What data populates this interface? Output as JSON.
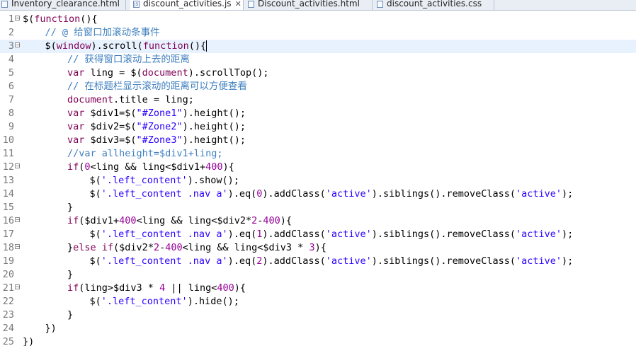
{
  "tabs": [
    {
      "label": "Inventory_clearance.html",
      "type": "html",
      "active": false,
      "closable": false
    },
    {
      "label": "discount_activities.js",
      "type": "js",
      "active": true,
      "closable": true
    },
    {
      "label": "Discount_activities.html",
      "type": "html",
      "active": false,
      "closable": false
    },
    {
      "label": "discount_activities.css",
      "type": "css",
      "active": false,
      "closable": false
    }
  ],
  "tab_icons": {
    "html": "html-file-icon",
    "js": "js-file-icon",
    "css": "css-file-icon"
  },
  "tab_close_label": "✕",
  "colors": {
    "comment": "#3f7fbf",
    "keyword": "#7f0055",
    "string": "#2a00ff",
    "number": "#990099",
    "plain": "#000000",
    "line_number": "#787878",
    "current_line": "#e8f2fe"
  },
  "editor": {
    "current_line": 3,
    "lines": [
      {
        "n": "1",
        "fold": true,
        "indent": 0,
        "tokens": [
          [
            "plain",
            "$("
          ],
          [
            "keyword",
            "function"
          ],
          [
            "plain",
            "(){"
          ]
        ]
      },
      {
        "n": "2",
        "fold": false,
        "indent": 1,
        "tokens": [
          [
            "comment",
            "// @ 给窗口加滚动条事件"
          ]
        ]
      },
      {
        "n": "3",
        "fold": true,
        "indent": 1,
        "caret": true,
        "tokens": [
          [
            "plain",
            "$("
          ],
          [
            "keyword",
            "window"
          ],
          [
            "plain",
            ").scroll("
          ],
          [
            "keyword",
            "function"
          ],
          [
            "plain",
            "(){"
          ]
        ]
      },
      {
        "n": "4",
        "fold": false,
        "indent": 2,
        "tokens": [
          [
            "comment",
            "// 获得窗口滚动上去的距离"
          ]
        ]
      },
      {
        "n": "5",
        "fold": false,
        "indent": 2,
        "tokens": [
          [
            "keyword",
            "var"
          ],
          [
            "plain",
            " ling = $("
          ],
          [
            "keyword",
            "document"
          ],
          [
            "plain",
            ").scrollTop();"
          ]
        ]
      },
      {
        "n": "6",
        "fold": false,
        "indent": 2,
        "tokens": [
          [
            "comment",
            "// 在标题栏显示滚动的距离可以方便查看"
          ]
        ]
      },
      {
        "n": "7",
        "fold": false,
        "indent": 2,
        "tokens": [
          [
            "keyword",
            "document"
          ],
          [
            "plain",
            ".title = ling;"
          ]
        ]
      },
      {
        "n": "8",
        "fold": false,
        "indent": 2,
        "tokens": [
          [
            "keyword",
            "var"
          ],
          [
            "plain",
            " $div1=$("
          ],
          [
            "string",
            "\"#Zone1\""
          ],
          [
            "plain",
            ").height();"
          ]
        ]
      },
      {
        "n": "9",
        "fold": false,
        "indent": 2,
        "tokens": [
          [
            "keyword",
            "var"
          ],
          [
            "plain",
            " $div2=$("
          ],
          [
            "string",
            "\"#Zone2\""
          ],
          [
            "plain",
            ").height();"
          ]
        ]
      },
      {
        "n": "10",
        "fold": false,
        "indent": 2,
        "tokens": [
          [
            "keyword",
            "var"
          ],
          [
            "plain",
            " $div3=$("
          ],
          [
            "string",
            "\"#Zone3\""
          ],
          [
            "plain",
            ").height();"
          ]
        ]
      },
      {
        "n": "11",
        "fold": false,
        "indent": 2,
        "tokens": [
          [
            "comment",
            "//var allheight=$div1+ling;"
          ]
        ]
      },
      {
        "n": "12",
        "fold": true,
        "indent": 2,
        "tokens": [
          [
            "keyword",
            "if"
          ],
          [
            "plain",
            "("
          ],
          [
            "number",
            "0"
          ],
          [
            "plain",
            "<ling && ling<$div1+"
          ],
          [
            "number",
            "400"
          ],
          [
            "plain",
            "){"
          ]
        ]
      },
      {
        "n": "13",
        "fold": false,
        "indent": 3,
        "tokens": [
          [
            "plain",
            "$("
          ],
          [
            "string",
            "'.left_content'"
          ],
          [
            "plain",
            ").show();"
          ]
        ]
      },
      {
        "n": "14",
        "fold": false,
        "indent": 3,
        "tokens": [
          [
            "plain",
            "$("
          ],
          [
            "string",
            "'.left_content .nav a'"
          ],
          [
            "plain",
            ").eq("
          ],
          [
            "number",
            "0"
          ],
          [
            "plain",
            ").addClass("
          ],
          [
            "string",
            "'active'"
          ],
          [
            "plain",
            ").siblings().removeClass("
          ],
          [
            "string",
            "'active'"
          ],
          [
            "plain",
            ");"
          ]
        ]
      },
      {
        "n": "15",
        "fold": false,
        "indent": 2,
        "tokens": [
          [
            "plain",
            "}"
          ]
        ]
      },
      {
        "n": "16",
        "fold": true,
        "indent": 2,
        "tokens": [
          [
            "keyword",
            "if"
          ],
          [
            "plain",
            "($div1+"
          ],
          [
            "number",
            "400"
          ],
          [
            "plain",
            "<ling && ling<$div2*"
          ],
          [
            "number",
            "2"
          ],
          [
            "plain",
            "-"
          ],
          [
            "number",
            "400"
          ],
          [
            "plain",
            "){"
          ]
        ]
      },
      {
        "n": "17",
        "fold": false,
        "indent": 3,
        "tokens": [
          [
            "plain",
            "$("
          ],
          [
            "string",
            "'.left_content .nav a'"
          ],
          [
            "plain",
            ").eq("
          ],
          [
            "number",
            "1"
          ],
          [
            "plain",
            ").addClass("
          ],
          [
            "string",
            "'active'"
          ],
          [
            "plain",
            ").siblings().removeClass("
          ],
          [
            "string",
            "'active'"
          ],
          [
            "plain",
            ");"
          ]
        ]
      },
      {
        "n": "18",
        "fold": true,
        "indent": 2,
        "tokens": [
          [
            "plain",
            "}"
          ],
          [
            "keyword",
            "else if"
          ],
          [
            "plain",
            "($div2*"
          ],
          [
            "number",
            "2"
          ],
          [
            "plain",
            "-"
          ],
          [
            "number",
            "400"
          ],
          [
            "plain",
            "<ling && ling<$div3 * "
          ],
          [
            "number",
            "3"
          ],
          [
            "plain",
            "){"
          ]
        ]
      },
      {
        "n": "19",
        "fold": false,
        "indent": 3,
        "tokens": [
          [
            "plain",
            "$("
          ],
          [
            "string",
            "'.left_content .nav a'"
          ],
          [
            "plain",
            ").eq("
          ],
          [
            "number",
            "2"
          ],
          [
            "plain",
            ").addClass("
          ],
          [
            "string",
            "'active'"
          ],
          [
            "plain",
            ").siblings().removeClass("
          ],
          [
            "string",
            "'active'"
          ],
          [
            "plain",
            ");"
          ]
        ]
      },
      {
        "n": "20",
        "fold": false,
        "indent": 2,
        "tokens": [
          [
            "plain",
            "}"
          ]
        ]
      },
      {
        "n": "21",
        "fold": true,
        "indent": 2,
        "tokens": [
          [
            "keyword",
            "if"
          ],
          [
            "plain",
            "(ling>$div3 * "
          ],
          [
            "number",
            "4"
          ],
          [
            "plain",
            " || ling<"
          ],
          [
            "number",
            "400"
          ],
          [
            "plain",
            "){"
          ]
        ]
      },
      {
        "n": "22",
        "fold": false,
        "indent": 3,
        "tokens": [
          [
            "plain",
            "$("
          ],
          [
            "string",
            "'.left_content'"
          ],
          [
            "plain",
            ").hide();"
          ]
        ]
      },
      {
        "n": "23",
        "fold": false,
        "indent": 2,
        "tokens": [
          [
            "plain",
            "}"
          ]
        ]
      },
      {
        "n": "24",
        "fold": false,
        "indent": 1,
        "tokens": [
          [
            "plain",
            "})"
          ]
        ]
      },
      {
        "n": "25",
        "fold": false,
        "indent": 0,
        "tokens": [
          [
            "plain",
            "})"
          ]
        ]
      }
    ]
  }
}
